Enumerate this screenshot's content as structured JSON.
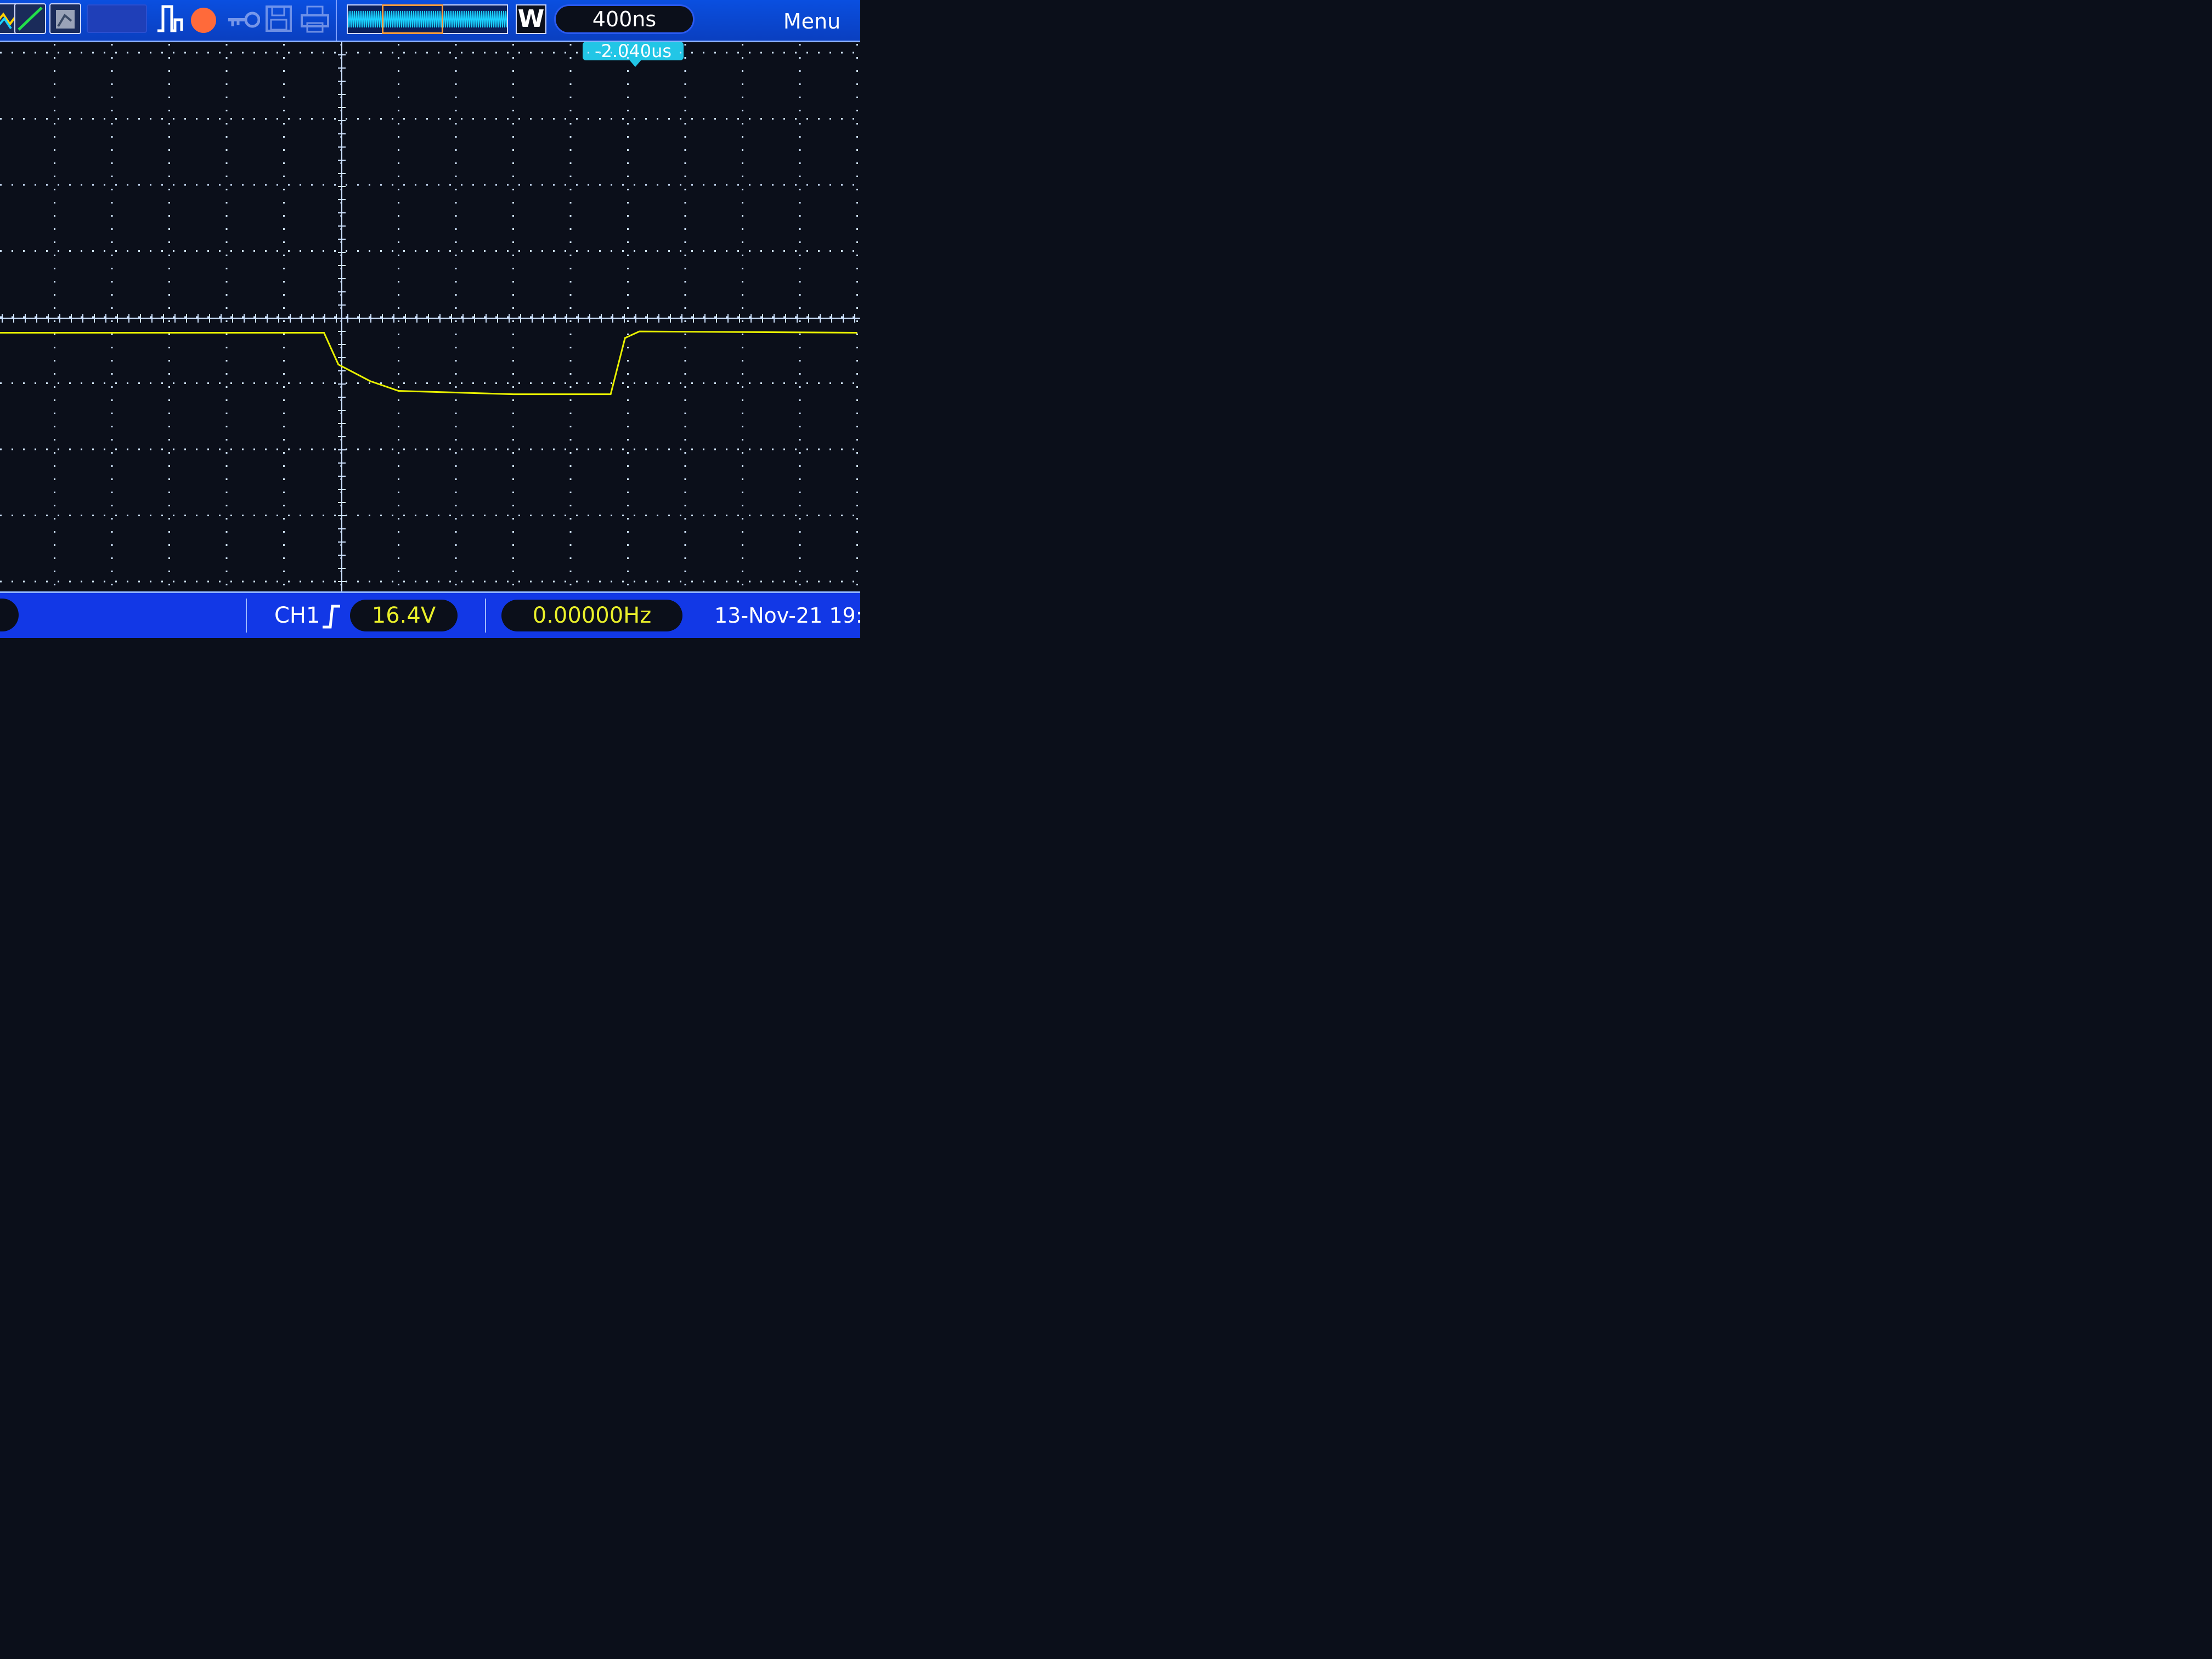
{
  "toolbar": {
    "icons": [
      "channel-icon",
      "probe-icon",
      "ref-icon",
      "pulse-icon",
      "stop-icon",
      "key-icon",
      "save-icon",
      "print-icon"
    ],
    "mode_label": "W",
    "timebase": "400ns",
    "menu_label": "Menu"
  },
  "trigger": {
    "offset": "-2.040us"
  },
  "status": {
    "channel": "CH1",
    "trigger_level": "16.4V",
    "frequency": "0.00000Hz",
    "datetime": "13-Nov-21 19:"
  },
  "colors": {
    "trace": "#e8f000",
    "grid": "#cfe3ff",
    "background": "#0b0f1a",
    "toolbar": "#0a4fe0",
    "statusbar": "#1238e6",
    "trigger_marker": "#22c6e6"
  },
  "chart_data": {
    "type": "line",
    "title": "",
    "xlabel": "",
    "ylabel": "",
    "x_divisions": 15,
    "y_divisions": 8,
    "series": [
      {
        "values": [
          [
            0,
            0.22
          ],
          [
            5.7,
            0.22
          ],
          [
            5.95,
            0.7
          ],
          [
            6.5,
            0.95
          ],
          [
            7,
            1.1
          ],
          [
            9,
            1.15
          ],
          [
            10.7,
            1.15
          ],
          [
            10.95,
            0.3
          ],
          [
            11.2,
            0.2
          ],
          [
            15,
            0.22
          ]
        ]
      }
    ]
  }
}
